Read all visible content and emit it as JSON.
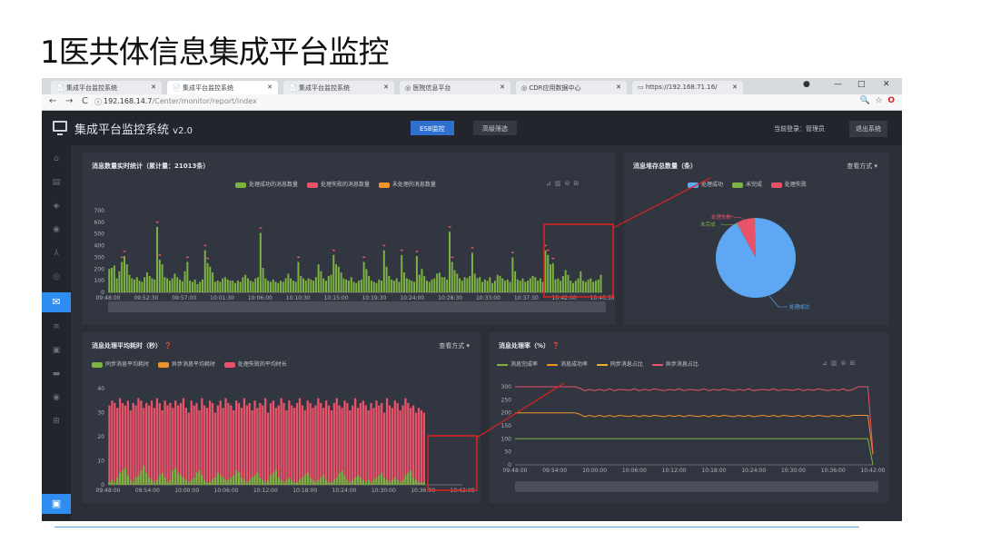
{
  "slide": {
    "title": "1医共体信息集成平台监控"
  },
  "browser": {
    "tabs": [
      "集成平台监控系统",
      "集成平台监控系统",
      "集成平台监控系统",
      "医院信息平台",
      "CDR应用数据中心",
      "https://192.168.71.16/"
    ],
    "url_host": "192.168.14.7",
    "url_path": "/Center/monitor/report/index",
    "win_controls": [
      "—",
      "□",
      "✕"
    ]
  },
  "app": {
    "title": "集成平台监控系统",
    "version": "v2.0",
    "tabs": [
      {
        "label": "ESB监控",
        "active": true
      },
      {
        "label": "高级筛选",
        "active": false
      }
    ],
    "login_label": "当前登录：管理员",
    "logout_label": "退出系统"
  },
  "panels": {
    "realtime": {
      "title": "消息数量实时统计（累计量：21013条）",
      "legend": [
        "处理成功的消息数量",
        "处理失败的消息数量",
        "未处理的消息数量"
      ],
      "legend_colors": [
        "#7cb342",
        "#e8536a",
        "#f0932b"
      ],
      "yticks": [
        "700",
        "600",
        "500",
        "400",
        "300",
        "200",
        "100",
        "0"
      ],
      "xticks": [
        "09:48:00",
        "09:52:30",
        "09:57:00",
        "10:01:30",
        "10:06:00",
        "10:10:30",
        "10:15:00",
        "10:19:30",
        "10:24:00",
        "10:28:30",
        "10:33:00",
        "10:37:30",
        "10:42:00",
        "10:46:30"
      ]
    },
    "storage": {
      "title": "消息堆存总数量（条）",
      "mode": "查看方式",
      "legend": [
        "处理成功",
        "未完成",
        "处理失败"
      ],
      "legend_colors": [
        "#5ea7f2",
        "#7cb342",
        "#e8536a"
      ],
      "labels": [
        "处理失败",
        "未完成",
        "处理成功"
      ]
    },
    "avgtime": {
      "title": "消息处理平均耗时（秒）",
      "mode": "查看方式",
      "legend": [
        "同步消息平均耗时",
        "异步消息平均耗时",
        "处理失败的平均时长"
      ],
      "legend_colors": [
        "#7cb342",
        "#f0932b",
        "#e8536a"
      ],
      "yticks": [
        "40",
        "30",
        "20",
        "10",
        "0"
      ],
      "xticks": [
        "09:48:00",
        "09:54:00",
        "10:00:00",
        "10:06:00",
        "10:12:00",
        "10:18:00",
        "10:24:00",
        "10:30:00",
        "10:36:00",
        "10:42:00"
      ]
    },
    "rate": {
      "title": "消息处理率（%）",
      "legend": [
        "消息完成率",
        "消息成功率",
        "同步消息占比",
        "异步消息占比"
      ],
      "legend_colors": [
        "#7cb342",
        "#f0932b",
        "#f0b02b",
        "#e8536a"
      ],
      "yticks": [
        "300",
        "250",
        "200",
        "150",
        "100",
        "50",
        "0"
      ],
      "xticks": [
        "09:48:00",
        "09:54:00",
        "10:00:00",
        "10:06:00",
        "10:12:00",
        "10:18:00",
        "10:24:00",
        "10:30:00",
        "10:36:00",
        "10:42:00"
      ]
    }
  },
  "chart_data": [
    {
      "type": "bar",
      "title": "消息数量实时统计（累计量：21013条）",
      "series": [
        {
          "name": "处理成功的消息数量",
          "values": [
            200,
            210,
            230,
            120,
            180,
            260,
            310,
            240,
            150,
            120,
            110,
            130,
            100,
            90,
            130,
            170,
            140,
            120,
            110,
            560,
            280,
            240,
            130,
            120,
            100,
            120,
            160,
            130,
            110,
            95,
            180,
            260,
            100,
            90,
            110,
            70,
            90,
            110,
            360,
            250,
            220,
            170,
            90,
            100,
            90,
            120,
            130,
            110,
            100,
            100,
            80,
            100,
            90,
            130,
            150,
            120,
            100,
            90,
            120,
            130,
            510,
            210,
            120,
            100,
            90,
            110,
            90,
            80,
            100,
            90,
            120,
            160,
            120,
            100,
            90,
            260,
            140,
            120,
            100,
            120,
            110,
            100,
            130,
            240,
            180,
            120,
            100,
            140,
            150,
            320,
            240,
            220,
            170,
            120,
            110,
            100,
            130,
            90,
            80,
            100,
            110,
            260,
            200,
            140,
            100,
            90,
            80,
            110,
            100,
            360,
            220,
            140,
            110,
            100,
            120,
            90,
            320,
            170,
            120,
            110,
            100,
            90,
            310,
            150,
            200,
            140,
            100,
            90,
            110,
            120,
            160,
            170,
            130,
            130,
            110,
            520,
            260,
            190,
            160,
            120,
            100,
            130,
            120,
            140,
            340,
            160,
            120,
            130,
            90,
            110,
            100,
            130,
            80,
            100,
            150,
            140,
            120,
            100,
            110,
            90,
            300,
            180,
            110,
            100,
            120,
            90,
            100,
            120,
            140,
            130,
            100,
            120,
            90,
            360,
            320,
            240,
            250,
            110,
            120,
            100,
            140,
            190,
            150,
            100,
            80,
            100,
            120,
            180,
            100,
            90,
            110,
            120,
            90,
            100,
            110,
            150
          ]
        }
      ],
      "xlabel": "",
      "ylabel": "",
      "ylim": [
        0,
        700
      ]
    },
    {
      "type": "pie",
      "title": "消息堆存总数量（条）",
      "categories": [
        "处理成功",
        "未完成",
        "处理失败"
      ],
      "values": [
        92,
        0.5,
        7.5
      ]
    },
    {
      "type": "bar",
      "title": "消息处理平均耗时（秒）",
      "series": [
        {
          "name": "同步消息平均耗时",
          "values": [
            1,
            2,
            1,
            3,
            5,
            6,
            7,
            4,
            2,
            1,
            3,
            4,
            6,
            8,
            5,
            3,
            2,
            1,
            2,
            4,
            5,
            3,
            1,
            2,
            6,
            7,
            5,
            4,
            3,
            2,
            1,
            2,
            3,
            5,
            6,
            4,
            2,
            1,
            1,
            2,
            3,
            5,
            4,
            3,
            2,
            2,
            3,
            4,
            6,
            5,
            3,
            2,
            1,
            2,
            3,
            4,
            5,
            3,
            2,
            1,
            2,
            4,
            5,
            6,
            3,
            2,
            1,
            2,
            3,
            2,
            1,
            1,
            2,
            3,
            4,
            5,
            3,
            2,
            1,
            2,
            3,
            4,
            2,
            1,
            1,
            2,
            3,
            5,
            6,
            4,
            2,
            1,
            2,
            3,
            4,
            3,
            2,
            1,
            2,
            1,
            2,
            3,
            4,
            5,
            3,
            2,
            1,
            2,
            3,
            2,
            1,
            2,
            4,
            5,
            6,
            3,
            2,
            1,
            1,
            1,
            0,
            0,
            0,
            0,
            0,
            0,
            0,
            0,
            0,
            0,
            0,
            0,
            0,
            0
          ]
        },
        {
          "name": "处理失败的平均时长",
          "values": [
            33,
            35,
            34,
            32,
            36,
            34,
            33,
            35,
            31,
            34,
            33,
            36,
            35,
            32,
            34,
            33,
            35,
            32,
            36,
            34,
            31,
            35,
            33,
            34,
            32,
            35,
            33,
            34,
            36,
            32,
            30,
            35,
            33,
            34,
            31,
            36,
            33,
            32,
            35,
            34,
            30,
            33,
            35,
            32,
            36,
            34,
            33,
            31,
            35,
            34,
            32,
            36,
            33,
            34,
            31,
            35,
            32,
            34,
            33,
            36,
            30,
            34,
            35,
            32,
            33,
            36,
            34,
            31,
            35,
            33,
            32,
            34,
            36,
            33,
            31,
            35,
            34,
            32,
            33,
            36,
            34,
            32,
            35,
            33,
            31,
            34,
            36,
            33,
            32,
            35,
            34,
            31,
            33,
            36,
            32,
            34,
            35,
            33,
            31,
            34,
            32,
            35,
            33,
            34,
            30,
            36,
            33,
            32,
            35,
            34,
            31,
            33,
            36,
            34,
            32,
            33,
            30,
            32,
            31,
            30,
            0,
            0,
            0,
            0,
            0,
            0,
            0,
            0,
            0,
            0,
            0,
            0,
            0,
            0
          ]
        }
      ],
      "xlabel": "",
      "ylabel": "",
      "ylim": [
        0,
        40
      ]
    },
    {
      "type": "line",
      "title": "消息处理率（%）",
      "series": [
        {
          "name": "消息完成率",
          "values": [
            100,
            100,
            100,
            100,
            100,
            100,
            100,
            100,
            100,
            100,
            100,
            100,
            100,
            100,
            100,
            100,
            100,
            100,
            100,
            100,
            100,
            100,
            100,
            100,
            100,
            100,
            100,
            100,
            100,
            100,
            100,
            100,
            100,
            100,
            100,
            100,
            100,
            100,
            100,
            100,
            100,
            100,
            100,
            100,
            100,
            100,
            100,
            100,
            100,
            100,
            100,
            100,
            100,
            100,
            100,
            100,
            100,
            100,
            100,
            100,
            100,
            100,
            100,
            100,
            100,
            100,
            100,
            100,
            100,
            100,
            100,
            100,
            0
          ]
        },
        {
          "name": "消息成功率",
          "values": [
            200,
            200,
            200,
            200,
            200,
            200,
            200,
            200,
            200,
            200,
            200,
            200,
            200,
            195,
            185,
            190,
            185,
            190,
            185,
            190,
            185,
            190,
            188,
            186,
            190,
            185,
            190,
            186,
            190,
            188,
            185,
            190,
            186,
            190,
            185,
            190,
            188,
            186,
            190,
            185,
            190,
            186,
            190,
            188,
            185,
            190,
            186,
            190,
            185,
            188,
            190,
            186,
            190,
            185,
            190,
            188,
            186,
            190,
            185,
            190,
            186,
            190,
            188,
            185,
            190,
            186,
            190,
            185,
            190,
            190,
            190,
            190,
            40
          ]
        },
        {
          "name": "异步消息占比",
          "values": [
            300,
            300,
            300,
            300,
            300,
            300,
            300,
            300,
            300,
            300,
            300,
            300,
            300,
            295,
            285,
            290,
            285,
            290,
            285,
            292,
            285,
            290,
            288,
            286,
            292,
            285,
            290,
            286,
            292,
            288,
            285,
            290,
            286,
            292,
            285,
            290,
            288,
            286,
            292,
            285,
            290,
            286,
            292,
            288,
            285,
            290,
            286,
            292,
            285,
            288,
            290,
            286,
            292,
            285,
            290,
            288,
            286,
            292,
            285,
            290,
            286,
            292,
            288,
            285,
            290,
            286,
            292,
            285,
            290,
            300,
            300,
            300,
            50
          ]
        }
      ],
      "xlabel": "",
      "ylabel": "",
      "ylim": [
        0,
        300
      ]
    }
  ]
}
